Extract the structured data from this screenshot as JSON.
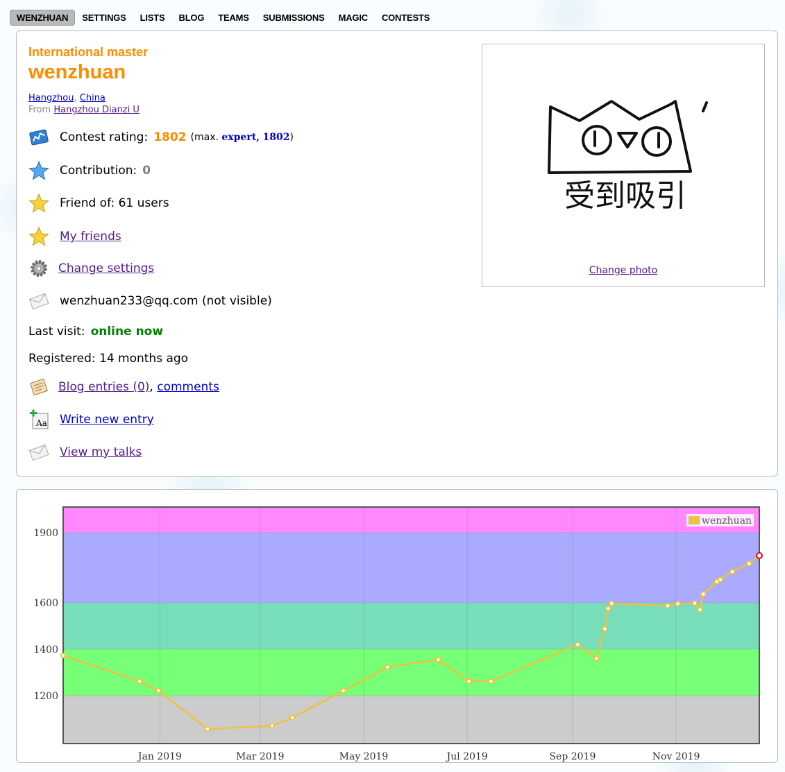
{
  "menu": {
    "items": [
      "WENZHUAN",
      "SETTINGS",
      "LISTS",
      "BLOG",
      "TEAMS",
      "SUBMISSIONS",
      "MAGIC",
      "CONTESTS"
    ],
    "active_index": 0
  },
  "profile": {
    "rank_title": "International master",
    "handle": "wenzhuan",
    "city": "Hangzhou",
    "country": "China",
    "from_label": "From",
    "organization": "Hangzhou Dianzi U",
    "rating_label": "Contest rating:",
    "rating": "1802",
    "max_open": "(max.",
    "max_rank": "expert,",
    "max_rating": "1802",
    "max_close": ")",
    "contribution_label": "Contribution:",
    "contribution": "0",
    "friend_of": "Friend of: 61 users",
    "my_friends": "My friends",
    "change_settings": "Change settings",
    "email": "wenzhuan233@qq.com (not visible)",
    "last_visit_label": "Last visit:",
    "last_visit": "online now",
    "registered": "Registered: 14 months ago",
    "blog_entries": "Blog entries (0)",
    "comments": "comments",
    "write_new_entry": "Write new entry",
    "view_my_talks": "View my talks",
    "change_photo": "Change photo",
    "avatar_caption": "受到吸引"
  },
  "colors": {
    "handle": "#ff8c00",
    "band_pink": "#ff88ff",
    "band_purple": "#aaaaff",
    "band_teal": "#77ddbb",
    "band_green": "#77ff77",
    "band_gray": "#cccccc",
    "line": "#edc240"
  },
  "chart_data": {
    "type": "line",
    "series": [
      {
        "name": "wenzhuan",
        "points": [
          [
            "2018-11-05",
            1373
          ],
          [
            "2018-12-20",
            1262
          ],
          [
            "2018-12-31",
            1222
          ],
          [
            "2019-01-29",
            1106
          ],
          [
            "2019-03-08",
            1115
          ],
          [
            "2019-03-20",
            1138
          ],
          [
            "2019-04-19",
            1221
          ],
          [
            "2019-05-15",
            1323
          ],
          [
            "2019-06-14",
            1355
          ],
          [
            "2019-07-02",
            1262
          ],
          [
            "2019-07-15",
            1262
          ],
          [
            "2019-09-04",
            1420
          ],
          [
            "2019-09-15",
            1360
          ],
          [
            "2019-09-20",
            1488
          ],
          [
            "2019-09-22",
            1575
          ],
          [
            "2019-09-24",
            1597
          ],
          [
            "2019-10-27",
            1587
          ],
          [
            "2019-11-02",
            1596
          ],
          [
            "2019-11-12",
            1598
          ],
          [
            "2019-11-15",
            1570
          ],
          [
            "2019-11-17",
            1637
          ],
          [
            "2019-11-25",
            1691
          ],
          [
            "2019-11-27",
            1699
          ],
          [
            "2019-12-04",
            1733
          ],
          [
            "2019-12-14",
            1768
          ],
          [
            "2019-12-20",
            1802
          ]
        ]
      }
    ],
    "bands": [
      {
        "from": 1000,
        "to": 1200,
        "color": "#cccccc"
      },
      {
        "from": 1200,
        "to": 1400,
        "color": "#77ff77"
      },
      {
        "from": 1400,
        "to": 1600,
        "color": "#77ddbb"
      },
      {
        "from": 1600,
        "to": 1900,
        "color": "#aaaaff"
      },
      {
        "from": 1900,
        "to": 2100,
        "color": "#ff88ff"
      }
    ],
    "yticks": [
      1200,
      1400,
      1600,
      1900
    ],
    "xticks": [
      {
        "date": "2019-01-01",
        "label": "Jan 2019"
      },
      {
        "date": "2019-03-01",
        "label": "Mar 2019"
      },
      {
        "date": "2019-05-01",
        "label": "May 2019"
      },
      {
        "date": "2019-07-01",
        "label": "Jul 2019"
      },
      {
        "date": "2019-09-01",
        "label": "Sep 2019"
      },
      {
        "date": "2019-11-01",
        "label": "Nov 2019"
      }
    ],
    "xlim": [
      "2018-11-05",
      "2019-12-20"
    ],
    "legend": "top-right",
    "grid": true
  }
}
